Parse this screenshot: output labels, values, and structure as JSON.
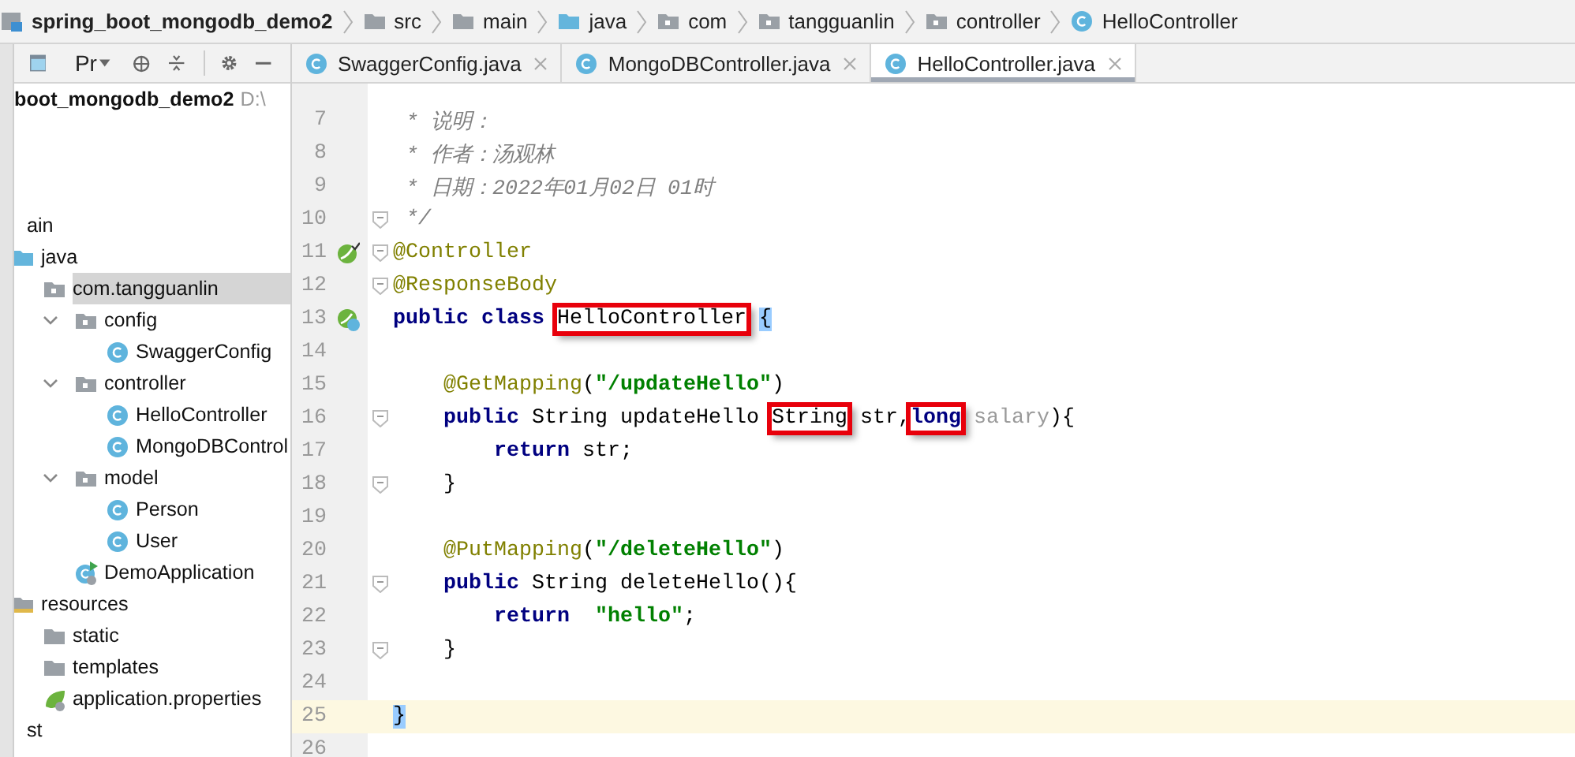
{
  "breadcrumbs": [
    {
      "label": "spring_boot_mongodb_demo2",
      "kind": "module"
    },
    {
      "label": "src",
      "kind": "folder"
    },
    {
      "label": "main",
      "kind": "folder"
    },
    {
      "label": "java",
      "kind": "source"
    },
    {
      "label": "com",
      "kind": "package"
    },
    {
      "label": "tangguanlin",
      "kind": "package"
    },
    {
      "label": "controller",
      "kind": "package"
    },
    {
      "label": "HelloController",
      "kind": "class"
    }
  ],
  "project_panel": {
    "view_label": "Pr",
    "root": {
      "name": "boot_mongodb_demo2",
      "path": "D:\\"
    },
    "tree": [
      {
        "label": "ain",
        "selected": false,
        "children": [
          {
            "label": "java",
            "kind": "source",
            "selected": false,
            "children": [
              {
                "label": "com.tangguanlin",
                "kind": "package",
                "selected": true,
                "children": [
                  {
                    "label": "config",
                    "kind": "package",
                    "selected": false,
                    "expanded": true,
                    "children": [
                      {
                        "label": "SwaggerConfig",
                        "kind": "class",
                        "selected": false
                      }
                    ]
                  },
                  {
                    "label": "controller",
                    "kind": "package",
                    "selected": false,
                    "expanded": true,
                    "children": [
                      {
                        "label": "HelloController",
                        "kind": "class",
                        "selected": false
                      },
                      {
                        "label": "MongoDBControl",
                        "kind": "class",
                        "selected": false
                      }
                    ]
                  },
                  {
                    "label": "model",
                    "kind": "package",
                    "selected": false,
                    "expanded": true,
                    "children": [
                      {
                        "label": "Person",
                        "kind": "class",
                        "selected": false
                      },
                      {
                        "label": "User",
                        "kind": "class",
                        "selected": false
                      }
                    ]
                  },
                  {
                    "label": "DemoApplication",
                    "kind": "app",
                    "selected": false
                  }
                ]
              }
            ]
          },
          {
            "label": "resources",
            "kind": "resources",
            "selected": false,
            "children": [
              {
                "label": "static",
                "kind": "folder",
                "selected": false
              },
              {
                "label": "templates",
                "kind": "folder",
                "selected": false
              },
              {
                "label": "application.properties",
                "kind": "props",
                "selected": false
              }
            ]
          }
        ]
      },
      {
        "label": "st",
        "selected": false
      }
    ]
  },
  "tabs": [
    {
      "label": "SwaggerConfig.java",
      "selected": false
    },
    {
      "label": "MongoDBController.java",
      "selected": false
    },
    {
      "label": "HelloController.java",
      "selected": true
    }
  ],
  "code_lines": [
    {
      "number": "7",
      "tokens": [
        {
          "text": " * 说明：",
          "kind": "comment"
        }
      ]
    },
    {
      "number": "8",
      "tokens": [
        {
          "text": " * 作者：汤观林",
          "kind": "comment"
        }
      ]
    },
    {
      "number": "9",
      "tokens": [
        {
          "text": " * 日期：2022年01月02日 01时",
          "kind": "comment"
        }
      ]
    },
    {
      "number": "10",
      "fold": true,
      "tokens": [
        {
          "text": " */",
          "kind": "comment"
        }
      ]
    },
    {
      "number": "11",
      "fold": true,
      "gutter": {
        "kind": "bean"
      },
      "tokens": [
        {
          "text": "@Controller",
          "kind": "annotation"
        }
      ]
    },
    {
      "number": "12",
      "fold": true,
      "tokens": [
        {
          "text": "@ResponseBody",
          "kind": "annotation"
        }
      ]
    },
    {
      "number": "13",
      "gutter": {
        "kind": "bean_class"
      },
      "tokens": [
        {
          "text": "public class ",
          "kind": "keyword"
        },
        {
          "text": "HelloController",
          "kind": "plain",
          "marked": true
        },
        {
          "text": " {",
          "kind": "plain",
          "matched": true
        }
      ]
    },
    {
      "number": "14"
    },
    {
      "number": "15",
      "tokens": [
        {
          "text": "    @GetMapping",
          "kind": "annotation"
        },
        {
          "text": "(",
          "kind": "plain"
        },
        {
          "text": "\"/updateHello\"",
          "kind": "string"
        },
        {
          "text": ")",
          "kind": "plain"
        }
      ]
    },
    {
      "number": "16",
      "fold": true,
      "tokens": [
        {
          "text": "    public ",
          "kind": "keyword"
        },
        {
          "text": "String updateHello ",
          "kind": "plain"
        },
        {
          "text": "String",
          "kind": "plain",
          "marked": true
        },
        {
          "text": " str,",
          "kind": "plain"
        },
        {
          "text": "long",
          "kind": "keyword",
          "marked": true
        },
        {
          "text": " salary",
          "kind": "unused"
        },
        {
          "text": "){",
          "kind": "plain"
        }
      ]
    },
    {
      "number": "17",
      "tokens": [
        {
          "text": "        return ",
          "kind": "keyword"
        },
        {
          "text": "str;",
          "kind": "plain"
        }
      ]
    },
    {
      "number": "18",
      "fold": true,
      "tokens": [
        {
          "text": "    }",
          "kind": "plain"
        }
      ]
    },
    {
      "number": "19"
    },
    {
      "number": "20",
      "tokens": [
        {
          "text": "    @PutMapping",
          "kind": "annotation"
        },
        {
          "text": "(",
          "kind": "plain"
        },
        {
          "text": "\"/deleteHello\"",
          "kind": "string"
        },
        {
          "text": ")",
          "kind": "plain"
        }
      ]
    },
    {
      "number": "21",
      "fold": true,
      "tokens": [
        {
          "text": "    public ",
          "kind": "keyword"
        },
        {
          "text": "String deleteHello(){",
          "kind": "plain"
        }
      ]
    },
    {
      "number": "22",
      "tokens": [
        {
          "text": "        return  ",
          "kind": "keyword"
        },
        {
          "text": "\"hello\"",
          "kind": "string"
        },
        {
          "text": ";",
          "kind": "plain"
        }
      ]
    },
    {
      "number": "23",
      "fold": true,
      "tokens": [
        {
          "text": "    }",
          "kind": "plain"
        }
      ]
    },
    {
      "number": "24"
    },
    {
      "number": "25",
      "current": true,
      "tokens": [
        {
          "text": "}",
          "kind": "plain",
          "matched": true
        }
      ]
    },
    {
      "number": "26"
    }
  ]
}
